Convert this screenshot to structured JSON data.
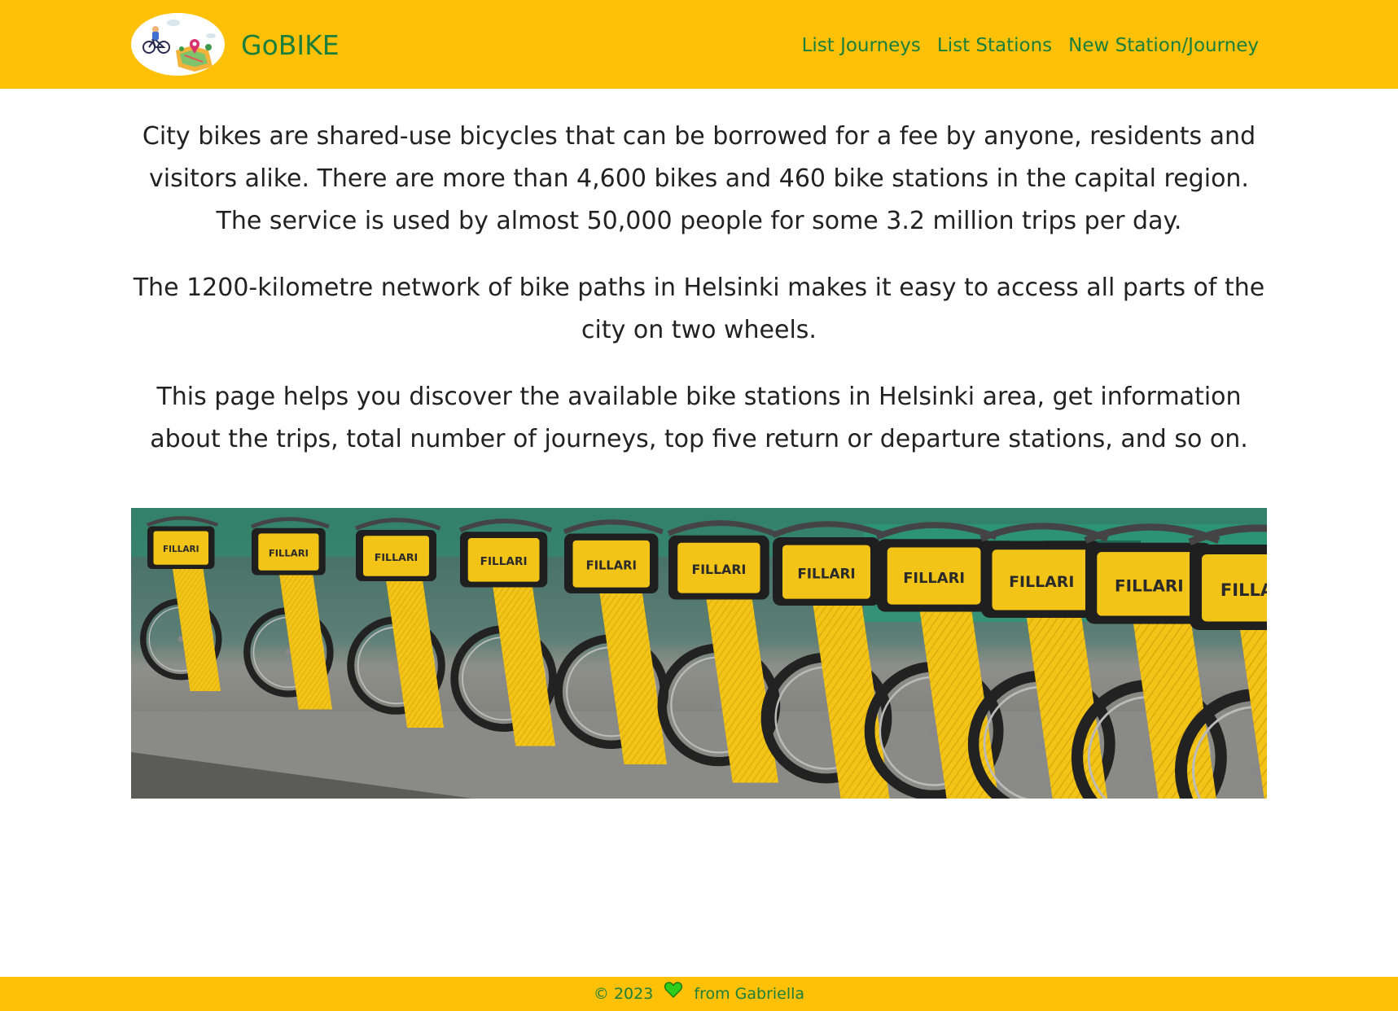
{
  "brand": {
    "name": "GoBIKE",
    "logo_icon": "bike-map-logo"
  },
  "nav": {
    "items": [
      {
        "label": "List Journeys"
      },
      {
        "label": "List Stations"
      },
      {
        "label": "New Station/Journey"
      }
    ]
  },
  "intro": {
    "paragraphs": [
      "City bikes are shared-use bicycles that can be borrowed for a fee by anyone, residents and visitors alike. There are more than 4,600 bikes and 460 bike stations in the capital region. The service is used by almost 50,000 people for some 3.2 million trips per day.",
      "The 1200-kilometre network of bike paths in Helsinki makes it easy to access all parts of the city on two wheels.",
      "This page helps you discover the available bike stations in Helsinki area, get information about the trips, total number of journeys, top five return or departure stations, and so on."
    ]
  },
  "hero": {
    "image_description_icon": "city-bikes-photo",
    "basket_label": "FILLARI",
    "bike_count": 11
  },
  "footer": {
    "prefix": "© 2023",
    "heart_icon": "heart-icon",
    "suffix": "from Gabriella"
  },
  "colors": {
    "accent": "#ffc107",
    "brand_text": "#1a7f3c",
    "body_text": "#222222",
    "heart": "#2ecc1b"
  }
}
